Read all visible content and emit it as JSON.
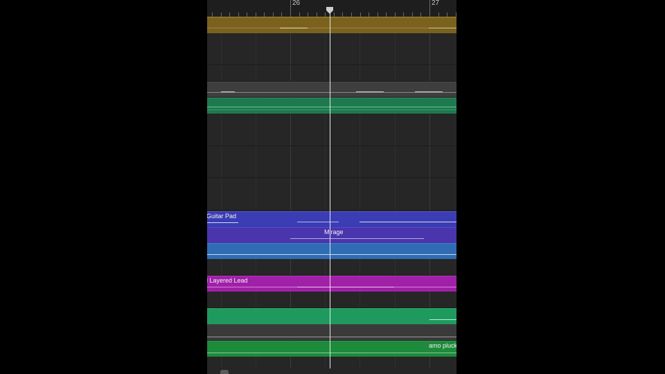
{
  "ruler": {
    "bar_labels": [
      "26",
      "27"
    ]
  },
  "regions": {
    "yellow": {
      "label": "",
      "color": "#7a621e"
    },
    "grey_audio": {
      "label": "",
      "color": "#3e3e3e"
    },
    "green_top": {
      "label": "",
      "color": "#1e7a4e"
    },
    "guitar_pad": {
      "label": "Guitar Pad",
      "color": "#3b3db4"
    },
    "mirage": {
      "label": "Mirage",
      "color": "#4a35ad"
    },
    "blue": {
      "label": "",
      "color": "#2f6cb3"
    },
    "layered_lead": {
      "label": "l Layered Lead",
      "color": "#a020a8"
    },
    "green_mid": {
      "label": "",
      "color": "#1e9a5e"
    },
    "grey_thin": {
      "label": "",
      "color": "#4a4a4a"
    },
    "amo_pluck": {
      "label": "amo pluck_",
      "color": "#1e8a3c"
    }
  },
  "colors": {
    "background": "#262626",
    "playhead": "#e8e8e8",
    "window_bg": "#000000"
  },
  "icons": {
    "playhead": "playhead-marker-icon"
  }
}
